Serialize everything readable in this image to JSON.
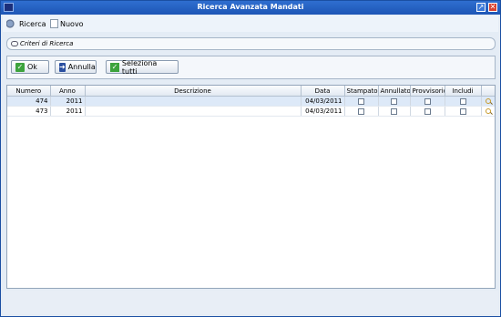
{
  "window": {
    "title": "Ricerca Avanzata Mandati"
  },
  "toolbar": {
    "search_label": "Ricerca",
    "new_label": "Nuovo"
  },
  "criteria": {
    "label": "Criteri di Ricerca"
  },
  "buttons": {
    "ok": "Ok",
    "cancel": "Annulla",
    "select_all": "Seleziona tutti"
  },
  "table": {
    "columns": [
      "Numero",
      "Anno",
      "Descrizione",
      "Data",
      "Stampato",
      "Annullato",
      "Provvisorio",
      "Includi"
    ],
    "rows": [
      {
        "numero": "474",
        "anno": "2011",
        "descrizione": "",
        "data": "04/03/2011",
        "stampato": false,
        "annullato": false,
        "provvisorio": false,
        "includi": false
      },
      {
        "numero": "473",
        "anno": "2011",
        "descrizione": "",
        "data": "04/03/2011",
        "stampato": false,
        "annullato": false,
        "provvisorio": false,
        "includi": false
      }
    ]
  },
  "colors": {
    "titlebar": "#1d55b5",
    "selected_row": "#dde9f8",
    "ok_icon": "#3da33d",
    "close_button": "#d8412f"
  },
  "icons": {
    "app": "app-window-icon",
    "search": "search-icon",
    "new": "new-document-icon",
    "criteria": "key-icon",
    "ok": "check-icon",
    "cancel": "arrow-right-icon",
    "select_all": "check-list-icon",
    "row_detail": "magnifier-icon"
  }
}
